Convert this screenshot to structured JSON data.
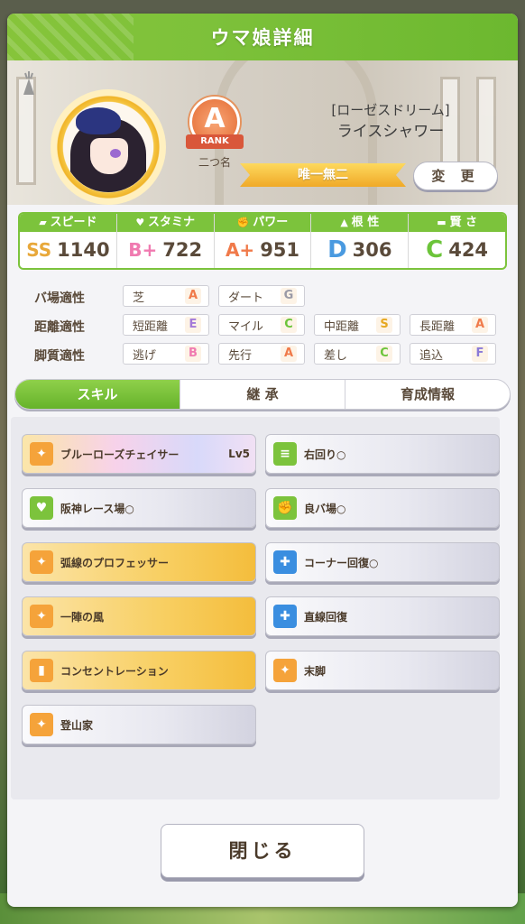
{
  "header": {
    "title": "ウマ娘詳細"
  },
  "profile": {
    "epithet": "[ローゼスドリーム]",
    "name": "ライスシャワー",
    "rank_letter": "A",
    "rank_label": "RANK",
    "rank_name": "二つ名",
    "title_band": "唯一無二",
    "change_label": "変 更"
  },
  "stats": [
    {
      "label": "スピード",
      "icon": "shoe-icon",
      "grade": "SS",
      "value": "1140",
      "color": "#e8a83a"
    },
    {
      "label": "スタミナ",
      "icon": "heart-icon",
      "grade": "B+",
      "value": "722",
      "color": "#f07ab0"
    },
    {
      "label": "パワー",
      "icon": "arm-icon",
      "grade": "A+",
      "value": "951",
      "color": "#f07a4a"
    },
    {
      "label": "根 性",
      "icon": "flame-icon",
      "grade": "D",
      "value": "306",
      "color": "#4a9ae0"
    },
    {
      "label": "賢 さ",
      "icon": "cap-icon",
      "grade": "C",
      "value": "424",
      "color": "#6cc43a"
    }
  ],
  "aptitude": {
    "rows": [
      {
        "label": "バ場適性",
        "items": [
          {
            "name": "芝",
            "grade": "A"
          },
          {
            "name": "ダート",
            "grade": "G"
          }
        ]
      },
      {
        "label": "距離適性",
        "items": [
          {
            "name": "短距離",
            "grade": "E"
          },
          {
            "name": "マイル",
            "grade": "C"
          },
          {
            "name": "中距離",
            "grade": "S"
          },
          {
            "name": "長距離",
            "grade": "A"
          }
        ]
      },
      {
        "label": "脚質適性",
        "items": [
          {
            "name": "逃げ",
            "grade": "B"
          },
          {
            "name": "先行",
            "grade": "A"
          },
          {
            "name": "差し",
            "grade": "C"
          },
          {
            "name": "追込",
            "grade": "F"
          }
        ]
      }
    ]
  },
  "tabs": [
    {
      "label": "スキル",
      "active": true
    },
    {
      "label": "継 承",
      "active": false
    },
    {
      "label": "育成情報",
      "active": false
    }
  ],
  "skills": [
    {
      "name": "ブルーローズチェイサー",
      "level": "Lv5",
      "style": "rainbow",
      "icon": "speed-icon"
    },
    {
      "name": "右回り○",
      "level": "",
      "style": "normal",
      "icon": "track-icon"
    },
    {
      "name": "阪神レース場○",
      "level": "",
      "style": "normal",
      "icon": "heart-icon"
    },
    {
      "name": "良バ場○",
      "level": "",
      "style": "normal",
      "icon": "arm-icon"
    },
    {
      "name": "弧線のプロフェッサー",
      "level": "",
      "style": "gold",
      "icon": "speed-icon"
    },
    {
      "name": "コーナー回復○",
      "level": "",
      "style": "normal",
      "icon": "recover-icon"
    },
    {
      "name": "一陣の風",
      "level": "",
      "style": "gold",
      "icon": "speed-icon"
    },
    {
      "name": "直線回復",
      "level": "",
      "style": "normal",
      "icon": "recover-icon"
    },
    {
      "name": "コンセントレーション",
      "level": "",
      "style": "gold",
      "icon": "gate-icon"
    },
    {
      "name": "末脚",
      "level": "",
      "style": "normal",
      "icon": "speed-icon"
    },
    {
      "name": "登山家",
      "level": "",
      "style": "normal",
      "icon": "speed-icon"
    }
  ],
  "close_label": "閉じる"
}
